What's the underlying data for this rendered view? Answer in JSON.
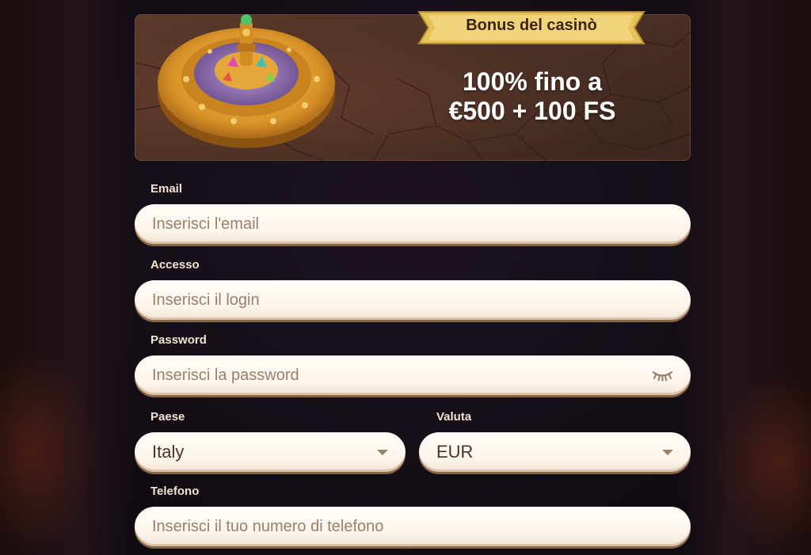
{
  "banner": {
    "ribbon_label": "Bonus del casinò",
    "promo_line1": "100% fino a",
    "promo_line2": "€500 + 100 FS"
  },
  "form": {
    "email": {
      "label": "Email",
      "placeholder": "Inserisci l'email",
      "value": ""
    },
    "login": {
      "label": "Accesso",
      "placeholder": "Inserisci il login",
      "value": ""
    },
    "password": {
      "label": "Password",
      "placeholder": "Inserisci la password",
      "value": "",
      "icon": "eye-closed-icon"
    },
    "country": {
      "label": "Paese",
      "value": "Italy",
      "icon": "chevron-down-icon"
    },
    "currency": {
      "label": "Valuta",
      "value": "EUR",
      "icon": "chevron-down-icon"
    },
    "phone": {
      "label": "Telefono",
      "placeholder": "Inserisci il tuo numero di telefono",
      "value": ""
    }
  },
  "colors": {
    "field_background": "#fcf5ec",
    "label_text": "#f3e4d2",
    "banner_ribbon": "#e0b84a",
    "page_background": "#140d16"
  }
}
